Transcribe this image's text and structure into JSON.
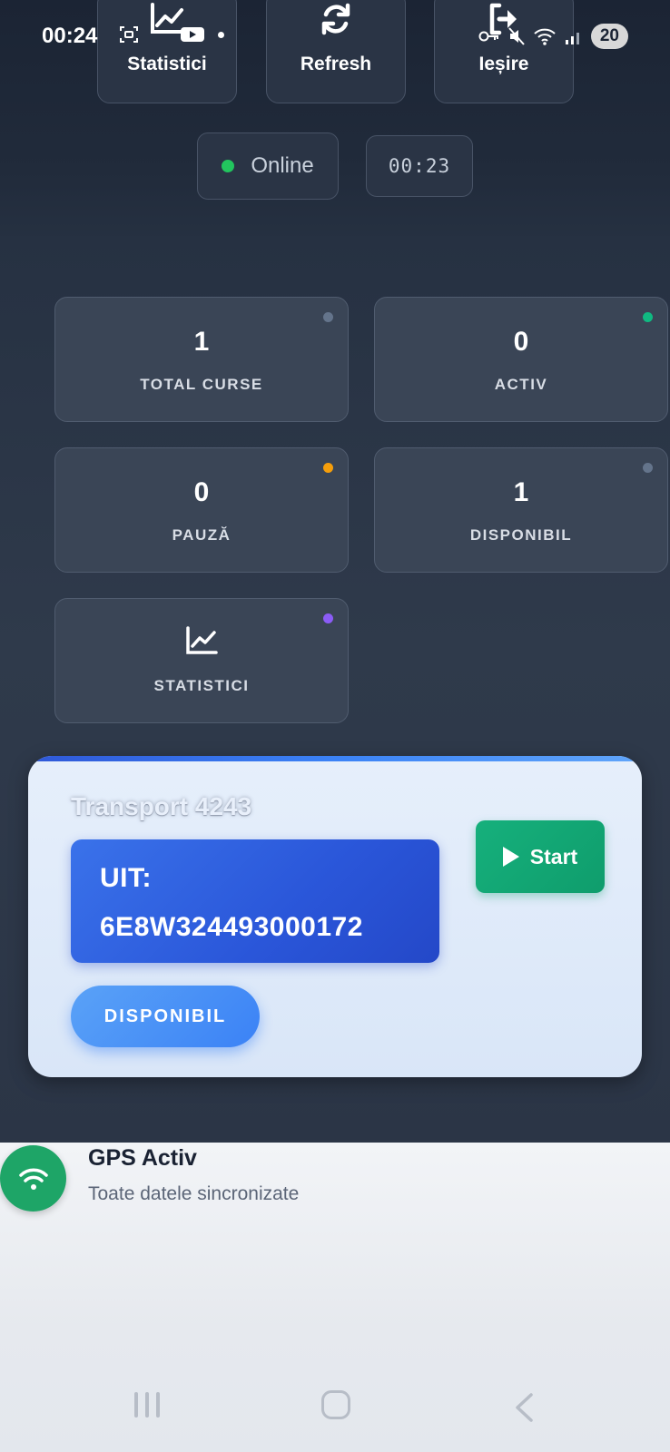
{
  "status_bar": {
    "time": "00:24",
    "battery": "20",
    "left_icons": [
      "screenshot-icon",
      "youtube-icon",
      "dot-icon"
    ],
    "right_icons": [
      "key-icon",
      "mute-icon",
      "wifi-icon",
      "signal-icon"
    ]
  },
  "toolbar": {
    "stats_label": "Statistici",
    "refresh_label": "Refresh",
    "exit_label": "Ieșire"
  },
  "connection": {
    "status": "Online",
    "clock": "00:23"
  },
  "stats": {
    "total": {
      "value": "1",
      "label": "TOTAL CURSE"
    },
    "active": {
      "value": "0",
      "label": "ACTIV"
    },
    "pause": {
      "value": "0",
      "label": "PAUZĂ"
    },
    "available": {
      "value": "1",
      "label": "DISPONIBIL"
    },
    "statistics": {
      "label": "STATISTICI"
    }
  },
  "colors": {
    "dot_total": "#64748b",
    "dot_active": "#10b981",
    "dot_pause": "#f59e0b",
    "dot_available": "#64748b",
    "dot_stats": "#8b5cf6"
  },
  "transport": {
    "title": "Transport 4243",
    "uit_label": "UIT:",
    "uit_code": "6E8W324493000172",
    "start_label": "Start",
    "status_label": "DISPONIBIL"
  },
  "gps": {
    "title": "GPS Activ",
    "subtitle": "Toate datele sincronizate"
  }
}
